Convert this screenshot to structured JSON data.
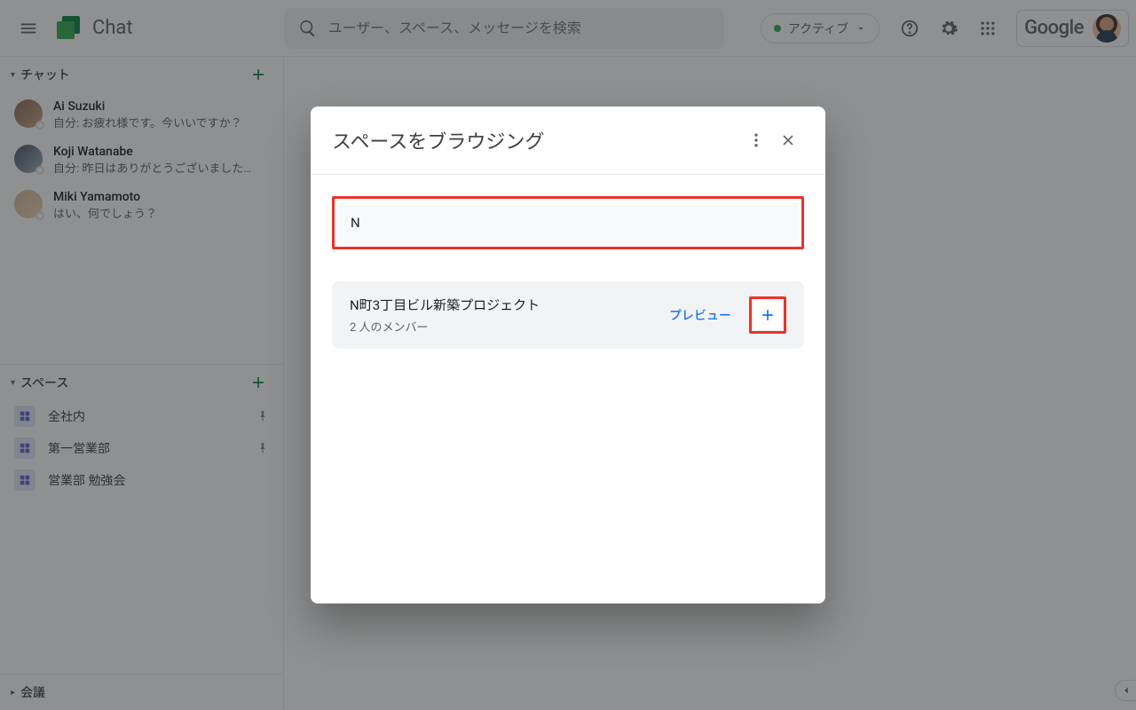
{
  "header": {
    "app_title": "Chat",
    "search_placeholder": "ユーザー、スペース、メッセージを検索",
    "status_label": "アクティブ",
    "google_label": "Google"
  },
  "sidebar": {
    "chats": {
      "title": "チャット",
      "items": [
        {
          "name": "Ai Suzuki",
          "preview": "自分: お疲れ様です。今いいですか？"
        },
        {
          "name": "Koji Watanabe",
          "preview": "自分: 昨日はありがとうございました…"
        },
        {
          "name": "Miki Yamamoto",
          "preview": "はい、何でしょう？"
        }
      ]
    },
    "spaces": {
      "title": "スペース",
      "items": [
        {
          "name": "全社内",
          "pinned": true
        },
        {
          "name": "第一営業部",
          "pinned": true
        },
        {
          "name": "営業部 勉強会",
          "pinned": false
        }
      ]
    },
    "meetings": {
      "title": "会議"
    }
  },
  "dialog": {
    "title": "スペースをブラウジング",
    "search_value": "N",
    "result": {
      "name": "N町3丁目ビル新築プロジェクト",
      "members": "2 人のメンバー",
      "preview_label": "プレビュー"
    }
  }
}
